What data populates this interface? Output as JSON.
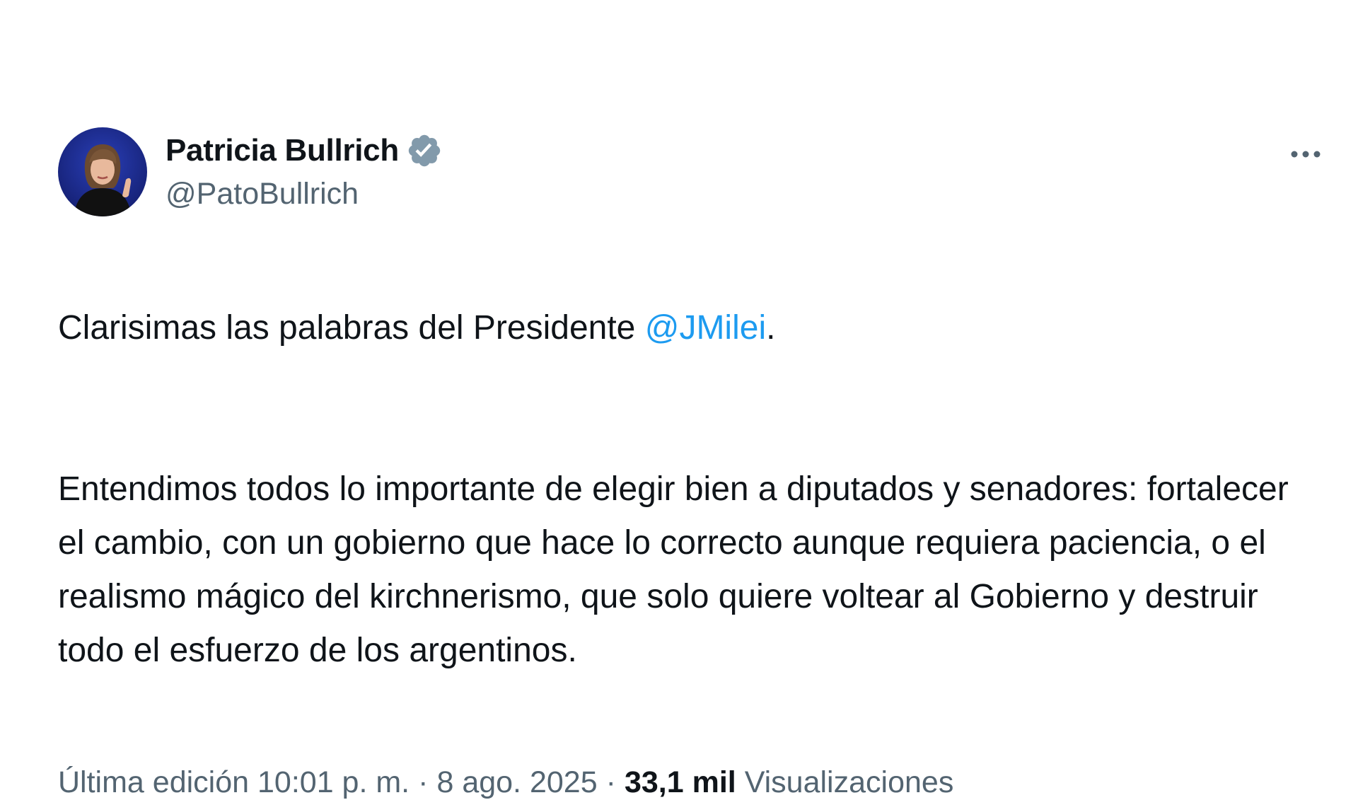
{
  "author": {
    "display_name": "Patricia Bullrich",
    "handle": "@PatoBullrich",
    "verified_icon": "verified-badge-icon",
    "avatar_bg": "#1b2a8c"
  },
  "tweet": {
    "line1_before": "Clarisimas las palabras del Presidente ",
    "mention": "@JMilei",
    "line1_after": ".",
    "paragraph2": "Entendimos todos lo importante de elegir bien a diputados y senadores: fortalecer el cambio, con un gobierno que hace lo correcto aunque requiera paciencia, o el realismo mágico del kirchnerismo, que solo quiere voltear al Gobierno y destruir todo el esfuerzo de los argentinos."
  },
  "meta": {
    "edited_time": "Última edición 10:01 p. m.",
    "separator": "·",
    "date": "8 ago. 2025",
    "views_count": "33,1 mil",
    "views_label": "Visualizaciones"
  },
  "colors": {
    "link": "#1d9bf0",
    "secondary": "#536471",
    "primary": "#0f1419",
    "verified": "#829aab"
  },
  "icons": {
    "more": "more-horizontal-icon"
  }
}
